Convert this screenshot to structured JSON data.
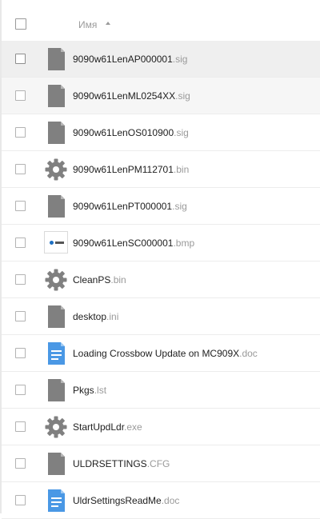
{
  "header": {
    "column_label": "Имя"
  },
  "files": [
    {
      "base": "9090w61LenAP000001",
      "ext": ".sig",
      "icon": "generic-file-icon",
      "selected": true
    },
    {
      "base": "9090w61LenML0254XX",
      "ext": ".sig",
      "icon": "generic-file-icon",
      "hover": true
    },
    {
      "base": "9090w61LenOS010900",
      "ext": ".sig",
      "icon": "generic-file-icon"
    },
    {
      "base": "9090w61LenPM112701",
      "ext": ".bin",
      "icon": "gear-icon"
    },
    {
      "base": "9090w61LenPT000001",
      "ext": ".sig",
      "icon": "generic-file-icon"
    },
    {
      "base": "9090w61LenSC000001",
      "ext": ".bmp",
      "icon": "image-thumbnail"
    },
    {
      "base": "CleanPS",
      "ext": ".bin",
      "icon": "gear-icon"
    },
    {
      "base": "desktop",
      "ext": ".ini",
      "icon": "generic-file-icon"
    },
    {
      "base": "Loading Crossbow Update on MC909X",
      "ext": ".doc",
      "icon": "document-icon"
    },
    {
      "base": "Pkgs",
      "ext": ".lst",
      "icon": "generic-file-icon"
    },
    {
      "base": "StartUpdLdr",
      "ext": ".exe",
      "icon": "gear-icon"
    },
    {
      "base": "ULDRSETTINGS",
      "ext": ".CFG",
      "icon": "generic-file-icon"
    },
    {
      "base": "UldrSettingsReadMe",
      "ext": ".doc",
      "icon": "document-icon"
    }
  ],
  "colors": {
    "icon_gray": "#808080",
    "doc_blue": "#4a98e5",
    "selected_row": "#efefef",
    "hover_row": "#f6f6f6"
  }
}
